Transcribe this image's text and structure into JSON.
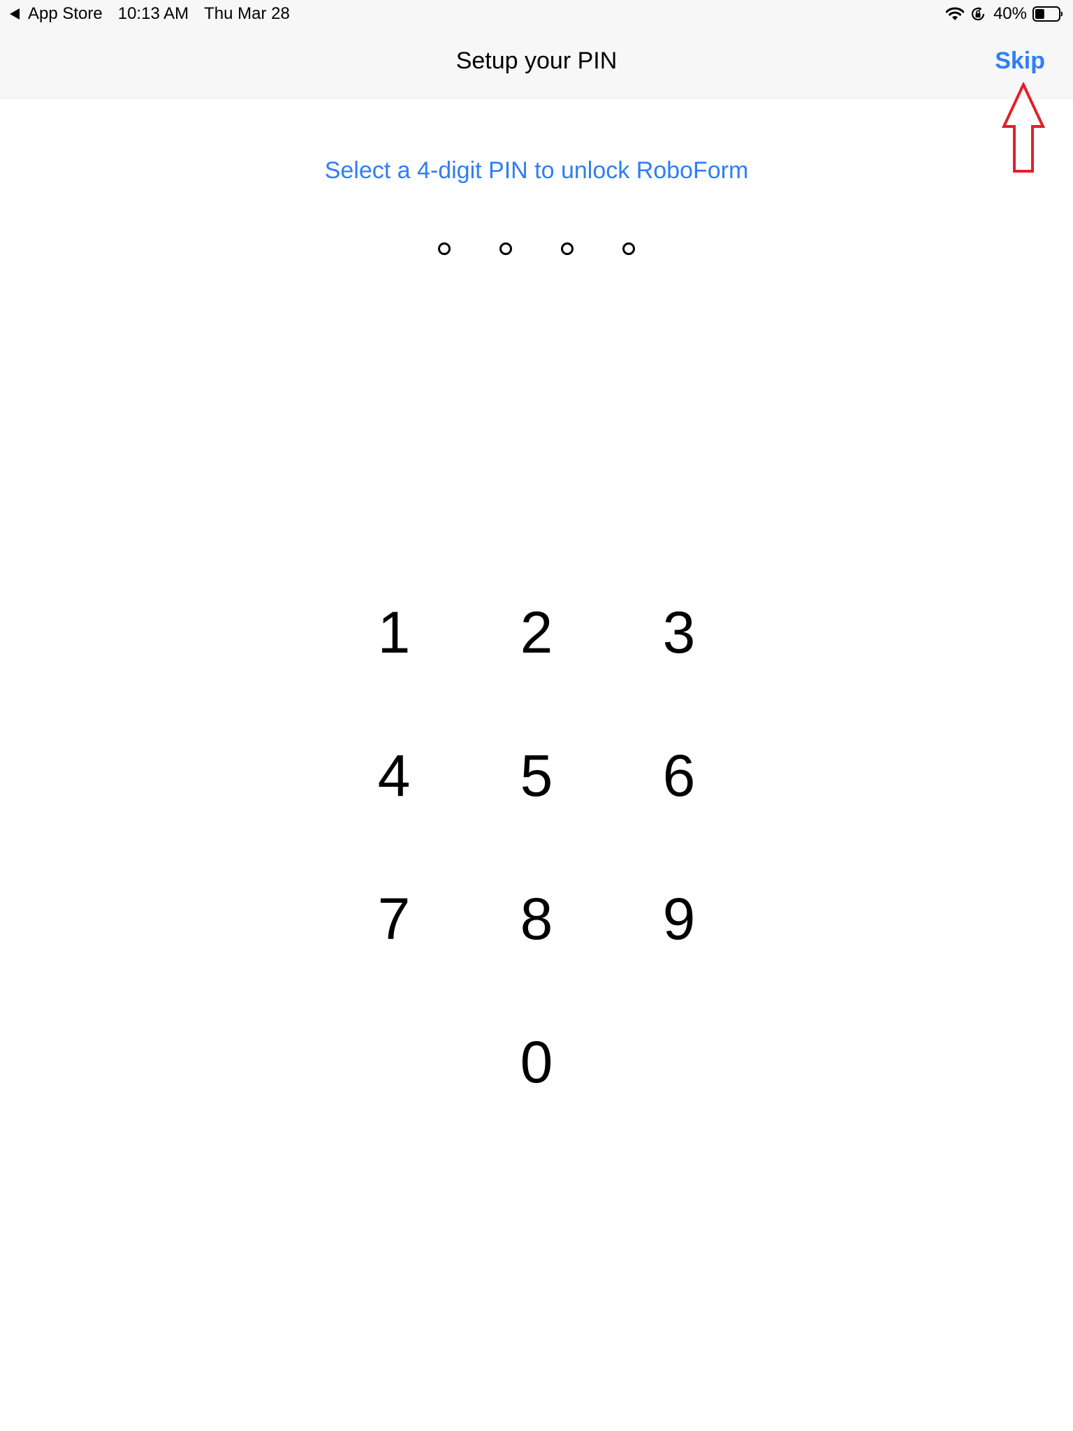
{
  "status_bar": {
    "back_app": "App Store",
    "time": "10:13 AM",
    "date": "Thu Mar 28",
    "battery_percent": "40%",
    "battery_level": 0.4
  },
  "nav": {
    "title": "Setup your PIN",
    "skip_label": "Skip"
  },
  "instruction": "Select a 4-digit PIN to unlock RoboForm",
  "pin": {
    "length": 4,
    "filled": 0
  },
  "keypad": {
    "keys": [
      "1",
      "2",
      "3",
      "4",
      "5",
      "6",
      "7",
      "8",
      "9",
      "0"
    ]
  },
  "colors": {
    "accent": "#2f7ef5",
    "annotation": "#e0202a",
    "bar_background": "#f7f7f7"
  }
}
